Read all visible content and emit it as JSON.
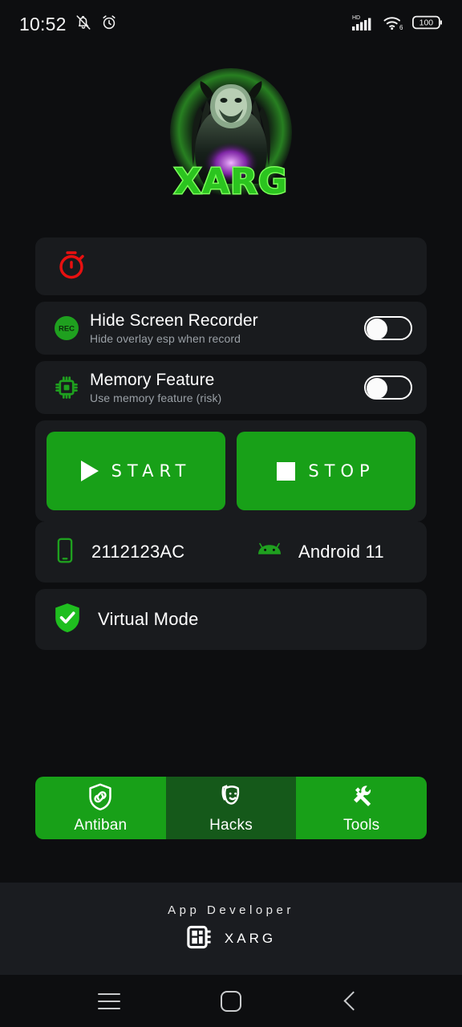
{
  "status_bar": {
    "time": "10:52",
    "icons_left": [
      "mute-icon",
      "alarm-icon"
    ],
    "network_label": "HD",
    "wifi_generation": "6",
    "battery_percent": "100"
  },
  "logo": {
    "brand_text": "XARG",
    "icon": "xarg-predator-logo",
    "glow_color": "#3ddc2f"
  },
  "timer_card": {
    "icon": "stopwatch-icon",
    "icon_color": "#e81010",
    "value": ""
  },
  "settings": [
    {
      "icon": "rec-icon",
      "icon_label": "REC",
      "title": "Hide Screen Recorder",
      "subtitle": "Hide overlay esp when record",
      "toggle_state": "off"
    },
    {
      "icon": "cpu-chip-icon",
      "title": "Memory Feature",
      "subtitle": "Use memory feature (risk)",
      "toggle_state": "off"
    }
  ],
  "actions": {
    "start_label": "START",
    "stop_label": "STOP",
    "start_icon": "play-icon",
    "stop_icon": "stop-icon",
    "button_color": "#18a018"
  },
  "device": {
    "phone_icon": "smartphone-icon",
    "model": "2112123AC",
    "os_icon": "android-icon",
    "os_version": "Android 11",
    "mode_icon": "shield-check-icon",
    "mode_label": "Virtual Mode"
  },
  "bottom_nav": [
    {
      "label": "Antiban",
      "icon": "shield-link-icon",
      "active": true
    },
    {
      "label": "Hacks",
      "icon": "masks-icon",
      "active": false
    },
    {
      "label": "Tools",
      "icon": "tools-icon",
      "active": true
    }
  ],
  "footer": {
    "developer_label": "App Developer",
    "developer_icon": "chip-icon",
    "developer_name": "XARG"
  },
  "system_nav": {
    "recents": "menu-icon",
    "home": "home-icon",
    "back": "back-icon"
  },
  "colors": {
    "accent_green": "#18a018",
    "dim_green": "#15591a",
    "card_bg": "#191b1e",
    "page_bg": "#0d0e10",
    "danger_red": "#e81010"
  }
}
